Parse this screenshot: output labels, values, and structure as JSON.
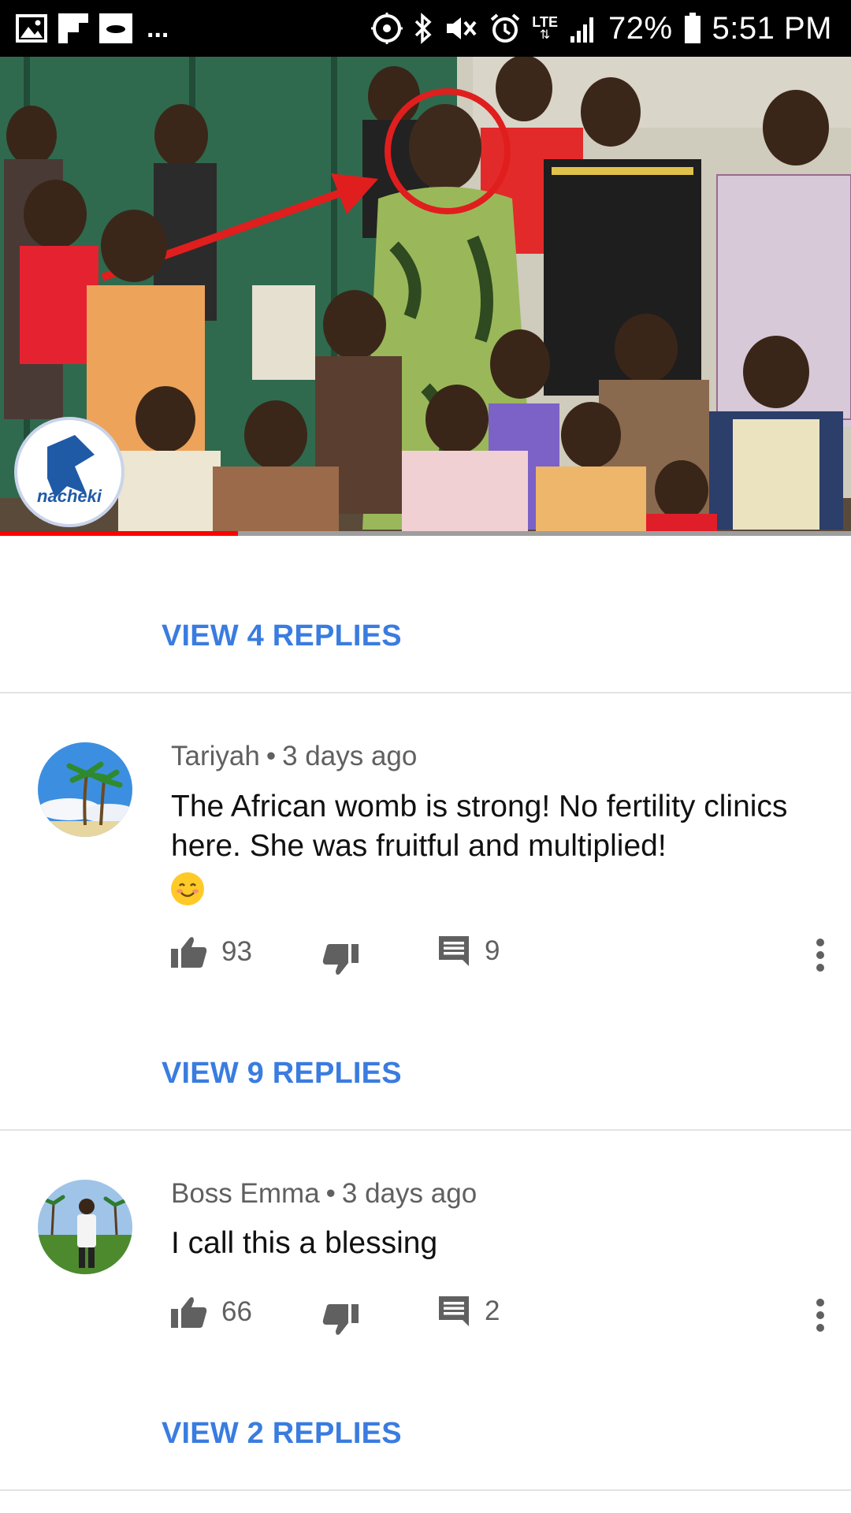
{
  "status_bar": {
    "battery": "72%",
    "time": "5:51 PM",
    "network": "LTE"
  },
  "video": {
    "channel_logo_text": "nacheki",
    "progress": 0.28
  },
  "comments": [
    {
      "view_replies_label": "VIEW 4 REPLIES"
    },
    {
      "author": "Tariyah",
      "separator": "•",
      "time": "3 days ago",
      "text": "The African womb is strong! No fertility clinics here. She was fruitful and multiplied!",
      "emoji": "smiling-face",
      "likes": "93",
      "reply_count": "9",
      "view_replies_label": "VIEW 9 REPLIES"
    },
    {
      "author": "Boss Emma",
      "separator": "•",
      "time": "3 days ago",
      "text": "I call this a blessing",
      "likes": "66",
      "reply_count": "2",
      "view_replies_label": "VIEW 2 REPLIES"
    }
  ],
  "colors": {
    "link": "#3a7ce0",
    "progress": "#ff0000",
    "status_bar": "#000000"
  },
  "icons": [
    "gallery-icon",
    "flipboard-icon",
    "app-icon",
    "location-icon",
    "bluetooth-icon",
    "mute-icon",
    "alarm-icon",
    "signal-icon",
    "battery-icon",
    "thumbs-up-icon",
    "thumbs-down-icon",
    "reply-icon",
    "more-vert-icon"
  ]
}
